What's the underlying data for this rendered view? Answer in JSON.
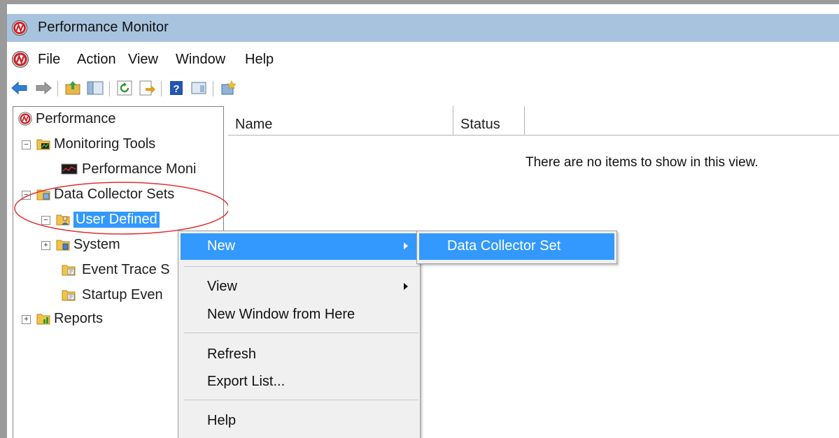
{
  "window": {
    "title": "Performance Monitor"
  },
  "menubar": {
    "items": [
      "File",
      "Action",
      "View",
      "Window",
      "Help"
    ]
  },
  "toolbar": {
    "buttons": [
      "back-icon",
      "forward-icon",
      "up-folder-icon",
      "show-hide-tree-icon",
      "refresh-icon",
      "export-list-icon",
      "help-icon",
      "properties-icon",
      "new-window-icon"
    ]
  },
  "tree": {
    "root": "Performance",
    "monitoring_tools": "Monitoring Tools",
    "performance_monitor": "Performance Moni",
    "data_collector_sets": "Data Collector Sets",
    "user_defined": "User Defined",
    "system": "System",
    "event_trace": "Event Trace S",
    "startup_events": "Startup Even",
    "reports": "Reports"
  },
  "list": {
    "columns": [
      "Name",
      "Status"
    ],
    "empty_message": "There are no items to show in this view."
  },
  "context_menu": {
    "new": "New",
    "view": "View",
    "new_window": "New Window from Here",
    "refresh": "Refresh",
    "export_list": "Export List...",
    "help": "Help"
  },
  "submenu": {
    "data_collector_set": "Data Collector Set"
  },
  "colors": {
    "titlebar": "#a8c3de",
    "highlight": "#3399ff",
    "annotation": "#e03030"
  }
}
